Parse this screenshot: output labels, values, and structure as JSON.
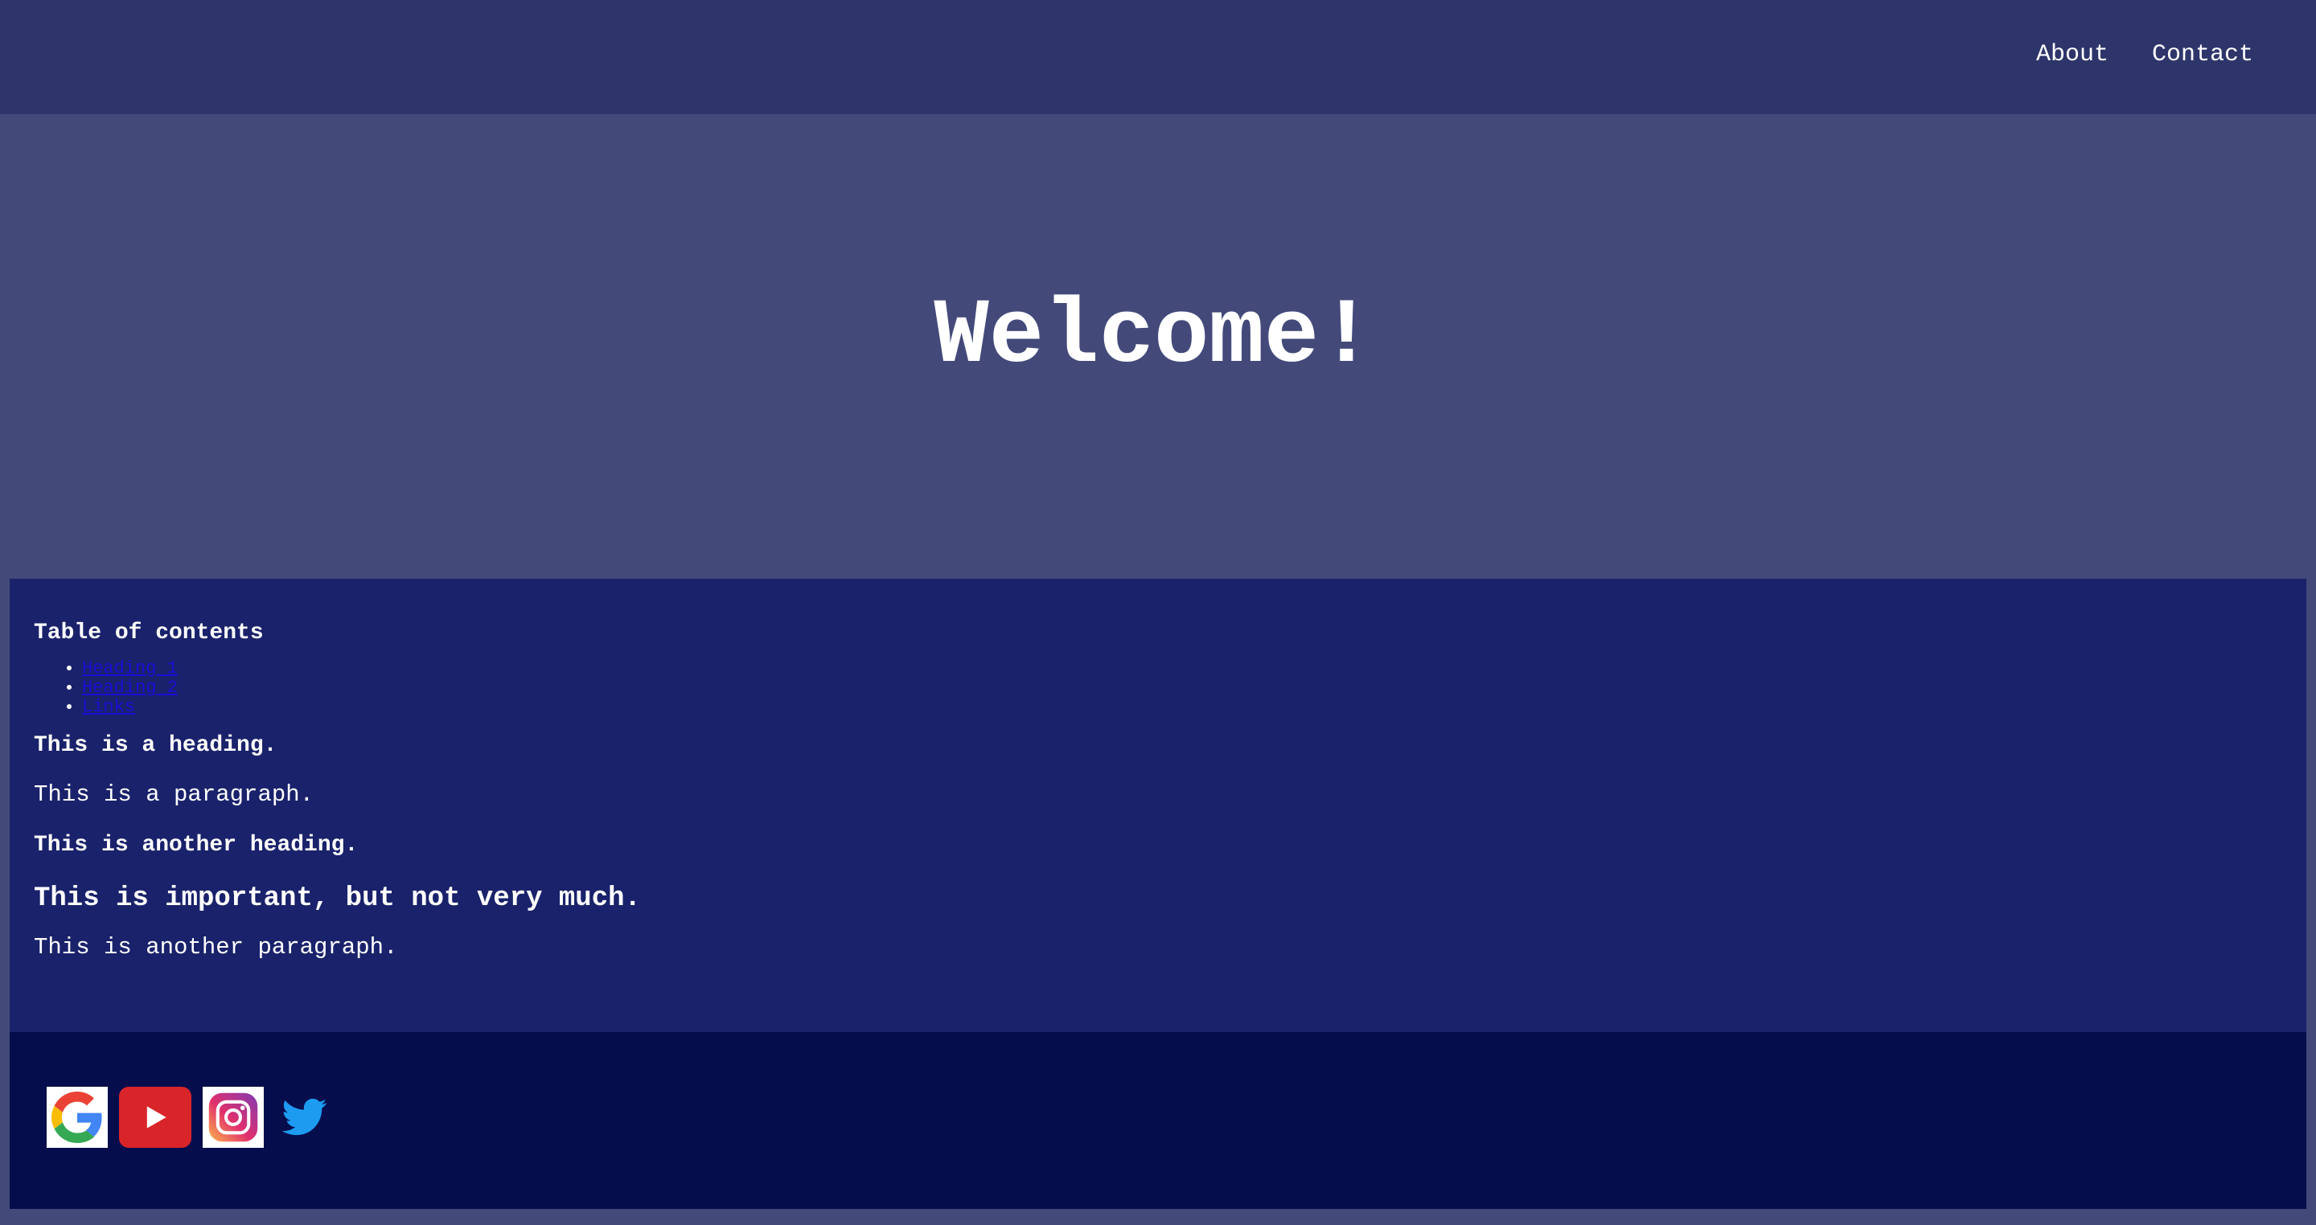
{
  "nav": {
    "items": [
      {
        "label": "About"
      },
      {
        "label": "Contact"
      }
    ]
  },
  "hero": {
    "title": "Welcome!"
  },
  "main": {
    "toc_title": "Table of contents",
    "toc_items": [
      {
        "label": "Heading 1"
      },
      {
        "label": "Heading 2"
      },
      {
        "label": "Links"
      }
    ],
    "heading1": "This is a heading.",
    "paragraph1": "This is a paragraph.",
    "heading2": "This is another heading.",
    "important": "This is important, but not very much.",
    "paragraph2": "This is another paragraph."
  },
  "footer": {
    "socials": [
      {
        "icon": "google-icon"
      },
      {
        "icon": "youtube-icon"
      },
      {
        "icon": "instagram-icon"
      },
      {
        "icon": "twitter-icon"
      }
    ]
  },
  "colors": {
    "topbar": "#2e356b",
    "hero": "#434a7a",
    "main": "#1a226b",
    "footer": "#060d4c",
    "link": "#1d0cd6",
    "text": "#ffffff"
  }
}
